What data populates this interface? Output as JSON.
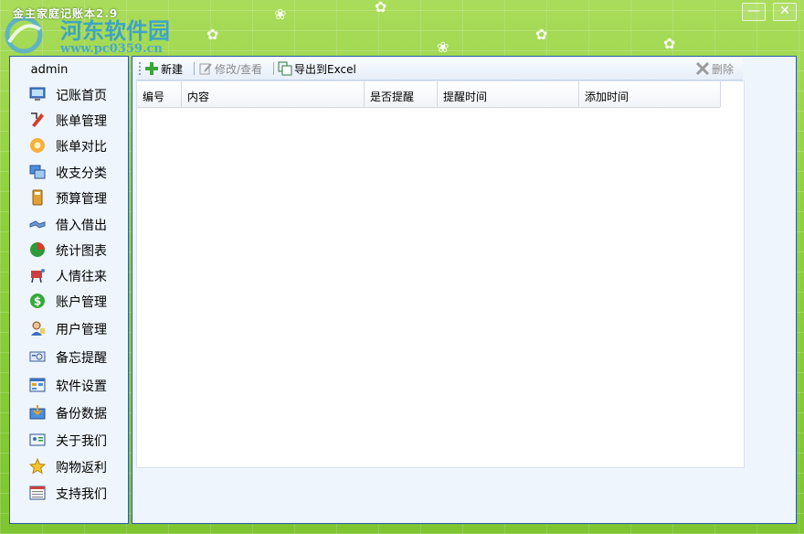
{
  "window": {
    "title": "金主家庭记账本2.9",
    "watermark": "河东软件园",
    "watermark_url": "www.pc0359.cn",
    "minimize": "—",
    "close": "✕"
  },
  "sidebar": {
    "user": "admin",
    "items": [
      {
        "label": "记账首页",
        "icon": "monitor-icon"
      },
      {
        "label": "账单管理",
        "icon": "pen-icon"
      },
      {
        "label": "账单对比",
        "icon": "flower-icon"
      },
      {
        "label": "收支分类",
        "icon": "windows-icon"
      },
      {
        "label": "预算管理",
        "icon": "calculator-icon"
      },
      {
        "label": "借入借出",
        "icon": "handshake-icon"
      },
      {
        "label": "统计图表",
        "icon": "pie-chart-icon"
      },
      {
        "label": "人情往来",
        "icon": "people-icon"
      },
      {
        "label": "账户管理",
        "icon": "dollar-icon"
      },
      {
        "label": "用户管理",
        "icon": "user-icon"
      },
      {
        "label": "备忘提醒",
        "icon": "memo-icon"
      },
      {
        "label": "软件设置",
        "icon": "settings-icon"
      },
      {
        "label": "备份数据",
        "icon": "backup-icon"
      },
      {
        "label": "关于我们",
        "icon": "id-card-icon"
      },
      {
        "label": "购物返利",
        "icon": "star-icon"
      },
      {
        "label": "支持我们",
        "icon": "list-icon"
      }
    ]
  },
  "toolbar": {
    "new_label": "新建",
    "edit_label": "修改/查看",
    "export_label": "导出到Excel",
    "delete_label": "删除"
  },
  "grid": {
    "columns": [
      "编号",
      "内容",
      "是否提醒",
      "提醒时间",
      "添加时间"
    ],
    "rows": []
  }
}
